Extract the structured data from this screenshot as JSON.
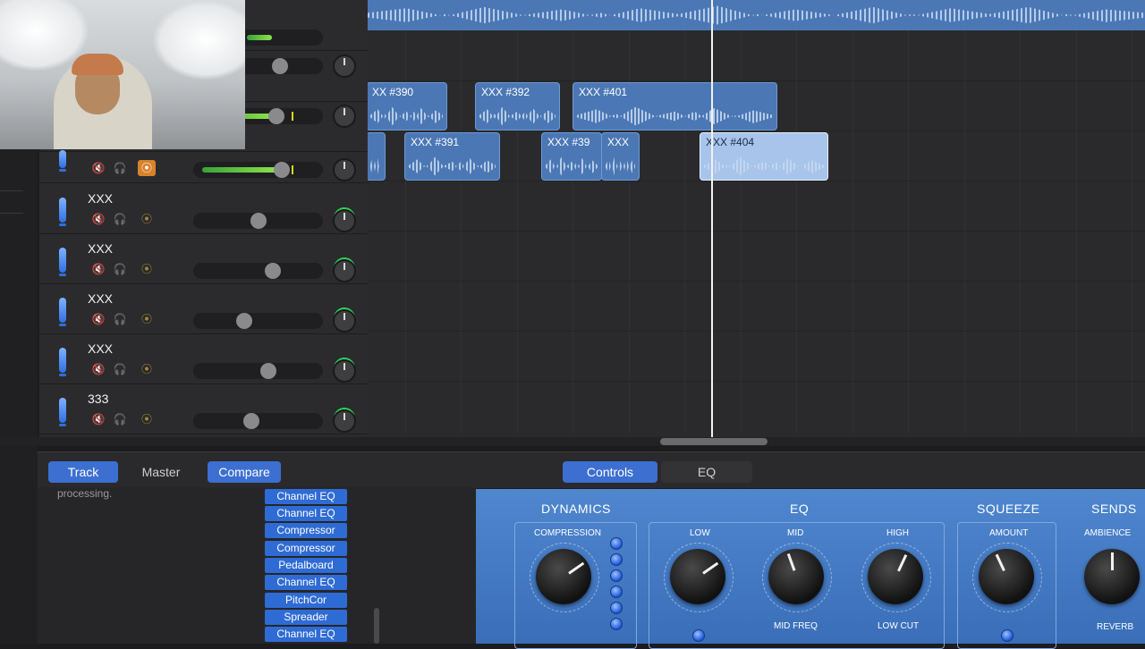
{
  "tracks": [
    {
      "name": "",
      "fader": 0.55,
      "meter": 0.6,
      "record_on": false
    },
    {
      "name": "",
      "fader": 0.55,
      "meter": 0,
      "record_on": false
    },
    {
      "name": "",
      "fader": 0.55,
      "meter": 0.6,
      "record_on": false
    },
    {
      "name": "",
      "fader": 0.62,
      "meter": 0.65,
      "record_on": true
    },
    {
      "name": "XXX",
      "fader": 0.5
    },
    {
      "name": "XXX",
      "fader": 0.62
    },
    {
      "name": "XXX",
      "fader": 0.38
    },
    {
      "name": "XXX",
      "fader": 0.58
    },
    {
      "name": "333",
      "fader": 0.44
    }
  ],
  "regions": {
    "r390": "XX #390",
    "r392": "XXX #392",
    "r401": "XXX #401",
    "r391": "XXX #391",
    "r39": "XXX #39",
    "rxxx": "XXX",
    "r404": "XXX #404"
  },
  "inspector_tabs": {
    "track": "Track",
    "master": "Master",
    "compare": "Compare"
  },
  "view_tabs": {
    "controls": "Controls",
    "eq": "EQ"
  },
  "processing_text": "processing.",
  "plugins": [
    "Channel EQ",
    "Channel EQ",
    "Compressor",
    "Compressor",
    "Pedalboard",
    "Channel EQ",
    "PitchCor",
    "Spreader",
    "Channel EQ"
  ],
  "smart_controls": {
    "dynamics": {
      "title": "DYNAMICS",
      "compression": "COMPRESSION"
    },
    "eq": {
      "title": "EQ",
      "low": "LOW",
      "mid": "MID",
      "high": "HIGH",
      "mid_freq": "MID FREQ",
      "low_cut": "LOW CUT"
    },
    "squeeze": {
      "title": "SQUEEZE",
      "amount": "AMOUNT"
    },
    "sends": {
      "title": "SENDS",
      "ambience": "AMBIENCE",
      "reverb": "REVERB"
    }
  },
  "colors": {
    "region": "#4b78b5",
    "accent": "#3d6fd1",
    "record": "#d9822b",
    "smart_bg": "#4f87cf"
  }
}
